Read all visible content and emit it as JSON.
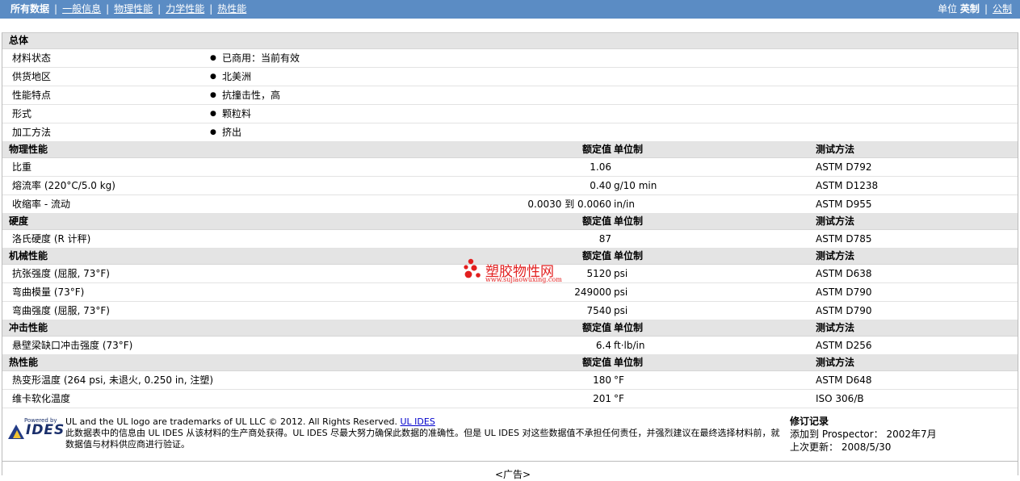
{
  "nav": {
    "all": "所有数据",
    "general": "一般信息",
    "physical": "物理性能",
    "mechanical": "力学性能",
    "thermal": "热性能",
    "units_label": "单位",
    "english": "英制",
    "metric": "公制"
  },
  "sections": [
    {
      "title": "总体",
      "rows": [
        {
          "name": "材料状态",
          "value": "已商用：当前有效"
        },
        {
          "name": "供货地区",
          "value": "北美洲"
        },
        {
          "name": "性能特点",
          "value": "抗撞击性，高"
        },
        {
          "name": "形式",
          "value": "颗粒料"
        },
        {
          "name": "加工方法",
          "value": "挤出"
        }
      ]
    },
    {
      "title": "物理性能",
      "col_value": "额定值",
      "col_unit": "单位制",
      "col_method": "测试方法",
      "rows": [
        {
          "name": "比重",
          "value": "1.06",
          "unit": "",
          "method": "ASTM D792"
        },
        {
          "name": "熔流率 (220°C/5.0 kg)",
          "value": "0.40",
          "unit": "g/10 min",
          "method": "ASTM D1238"
        },
        {
          "name": "收缩率 - 流动",
          "value": "0.0030 到 0.0060",
          "unit": "in/in",
          "method": "ASTM D955"
        }
      ]
    },
    {
      "title": "硬度",
      "col_value": "额定值",
      "col_unit": "单位制",
      "col_method": "测试方法",
      "rows": [
        {
          "name": "洛氏硬度 (R 计秤)",
          "value": "87",
          "unit": "",
          "method": "ASTM D785"
        }
      ]
    },
    {
      "title": "机械性能",
      "col_value": "额定值",
      "col_unit": "单位制",
      "col_method": "测试方法",
      "rows": [
        {
          "name": "抗张强度 (屈服, 73°F)",
          "value": "5120",
          "unit": "psi",
          "method": "ASTM D638"
        },
        {
          "name": "弯曲模量 (73°F)",
          "value": "249000",
          "unit": "psi",
          "method": "ASTM D790"
        },
        {
          "name": "弯曲强度 (屈服, 73°F)",
          "value": "7540",
          "unit": "psi",
          "method": "ASTM D790"
        }
      ]
    },
    {
      "title": "冲击性能",
      "col_value": "额定值",
      "col_unit": "单位制",
      "col_method": "测试方法",
      "rows": [
        {
          "name": "悬壁梁缺口冲击强度 (73°F)",
          "value": "6.4",
          "unit": "ft·lb/in",
          "method": "ASTM D256"
        }
      ]
    },
    {
      "title": "热性能",
      "col_value": "额定值",
      "col_unit": "单位制",
      "col_method": "测试方法",
      "rows": [
        {
          "name": "热变形温度 (264 psi, 未退火, 0.250 in, 注塑)",
          "value": "180",
          "unit": "°F",
          "method": "ASTM D648"
        },
        {
          "name": "维卡软化温度",
          "value": "201",
          "unit": "°F",
          "method": "ISO 306/B"
        }
      ]
    }
  ],
  "watermark": {
    "text": "塑胶物性网",
    "url": "www.sujiaowuxing.com"
  },
  "footer": {
    "logo_powered": "Powered by",
    "logo_name": "IDES",
    "trademark": "UL and the UL logo are trademarks of UL LLC © 2012. All Rights Reserved.",
    "link": "UL IDES",
    "disclaimer": "此数据表中的信息由 UL IDES 从该材料的生产商处获得。UL IDES 尽最大努力确保此数据的准确性。但是 UL IDES 对这些数据值不承担任何责任，并强烈建议在最终选择材料前，就数据值与材料供应商进行验证。",
    "rev_title": "修订记录",
    "added": "添加到 Prospector： 2002年7月",
    "updated": "上次更新： 2008/5/30",
    "ad": "<广告>"
  },
  "colors": {
    "nav_bg": "#5b8cc4",
    "section_bg": "#e4e4e4",
    "link": "#0000cc",
    "watermark": "#e21f1f"
  }
}
